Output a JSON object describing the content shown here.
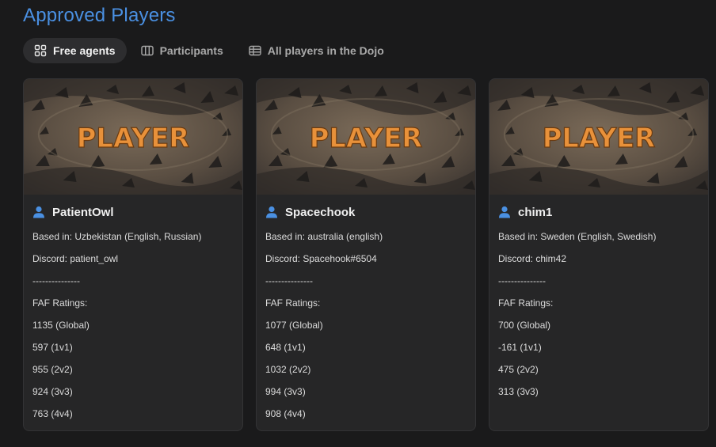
{
  "page": {
    "title": "Approved Players"
  },
  "tabs": [
    {
      "label": "Free agents",
      "icon": "grid-icon",
      "active": true
    },
    {
      "label": "Participants",
      "icon": "columns-icon",
      "active": false
    },
    {
      "label": "All players in the Dojo",
      "icon": "table-icon",
      "active": false
    }
  ],
  "colors": {
    "accent": "#4a90e2",
    "banner_text": "#e8913a",
    "background": "#1a1a1b",
    "card": "#262627"
  },
  "banner_text": "PLAYER",
  "players": [
    {
      "name": "PatientOwl",
      "based_in": "Based in: Uzbekistan (English, Russian)",
      "discord": "Discord: patient_owl",
      "separator": "---------------",
      "ratings_label": "FAF Ratings:",
      "ratings": [
        "1135 (Global)",
        "597 (1v1)",
        "955 (2v2)",
        "924 (3v3)",
        "763 (4v4)"
      ]
    },
    {
      "name": "Spacechook",
      "based_in": "Based in: australia (english)",
      "discord": "Discord: Spacehook#6504",
      "separator": "---------------",
      "ratings_label": "FAF Ratings:",
      "ratings": [
        "1077 (Global)",
        "648 (1v1)",
        "1032 (2v2)",
        "994 (3v3)",
        "908 (4v4)"
      ]
    },
    {
      "name": "chim1",
      "based_in": "Based in: Sweden (English, Swedish)",
      "discord": "Discord: chim42",
      "separator": "---------------",
      "ratings_label": "FAF Ratings:",
      "ratings": [
        "700 (Global)",
        "-161 (1v1)",
        "475 (2v2)",
        "313 (3v3)"
      ]
    }
  ]
}
